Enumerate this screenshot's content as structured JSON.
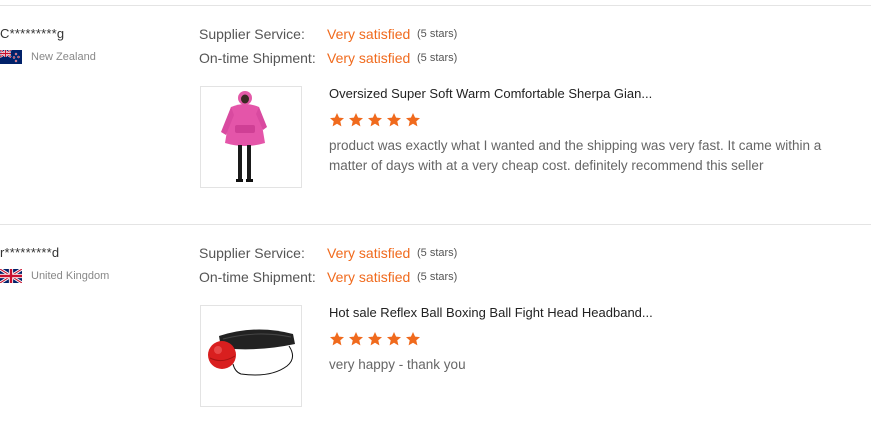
{
  "reviews": [
    {
      "buyer_name": "C*********g",
      "country": "New Zealand",
      "flag_icon": "new-zealand-flag-icon",
      "ratings": [
        {
          "label": "Supplier Service:",
          "value": "Very satisfied",
          "stars": "(5 stars)"
        },
        {
          "label": "On-time Shipment:",
          "value": "Very satisfied",
          "stars": "(5 stars)"
        }
      ],
      "product_title": "Oversized Super Soft Warm Comfortable Sherpa Gian...",
      "product_image_icon": "pink-hoodie-blanket-image",
      "star_rating": 5,
      "text": "product was exactly what I wanted and the shipping was very fast. It came within a matter of days with at a very cheap cost. definitely recommend this seller"
    },
    {
      "buyer_name": "r*********d",
      "country": "United Kingdom",
      "flag_icon": "united-kingdom-flag-icon",
      "ratings": [
        {
          "label": "Supplier Service:",
          "value": "Very satisfied",
          "stars": "(5 stars)"
        },
        {
          "label": "On-time Shipment:",
          "value": "Very satisfied",
          "stars": "(5 stars)"
        }
      ],
      "product_title": "Hot sale Reflex Ball Boxing Ball Fight Head Headband...",
      "product_image_icon": "reflex-boxing-ball-image",
      "star_rating": 5,
      "text": "very happy - thank you"
    }
  ],
  "colors": {
    "accent": "#f06a1d",
    "star": "#f06a1d",
    "divider": "#e4e4e4",
    "muted_text": "#888888"
  }
}
